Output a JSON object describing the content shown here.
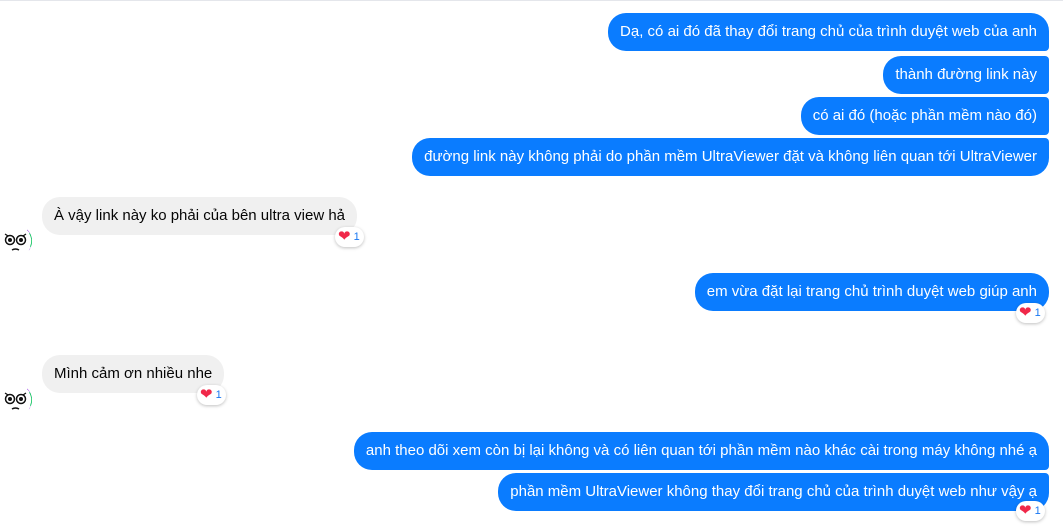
{
  "conversation": {
    "messages": [
      {
        "text": "Dạ, có ai đó đã thay đổi trang chủ của trình duyệt web của anh"
      },
      {
        "text": "thành đường link này"
      },
      {
        "text": "có ai đó (hoặc phần mềm nào đó)"
      },
      {
        "text": "đường link này không phải do phần mềm UltraViewer đặt và không liên quan tới UltraViewer"
      },
      {
        "text": "À vậy link này ko phải của bên ultra view hả",
        "reaction": {
          "emoji": "❤",
          "count": "1"
        }
      },
      {
        "text": "em vừa đặt lại trang chủ trình duyệt web giúp anh",
        "reaction": {
          "emoji": "❤",
          "count": "1"
        }
      },
      {
        "text": "Mình cảm ơn nhiều nhe",
        "reaction": {
          "emoji": "❤",
          "count": "1"
        }
      },
      {
        "text": "anh theo dõi xem còn bị lại không và có liên quan tới phần mềm nào khác cài trong máy không nhé ạ"
      },
      {
        "text": "phần mềm UltraViewer không thay đổi trang chủ của trình duyệt web như vậy ạ",
        "reaction": {
          "emoji": "❤",
          "count": "1"
        }
      }
    ]
  },
  "colors": {
    "outgoing_bubble": "#0a7cff",
    "incoming_bubble": "#f0f0f0",
    "reaction_heart": "#f02849"
  }
}
